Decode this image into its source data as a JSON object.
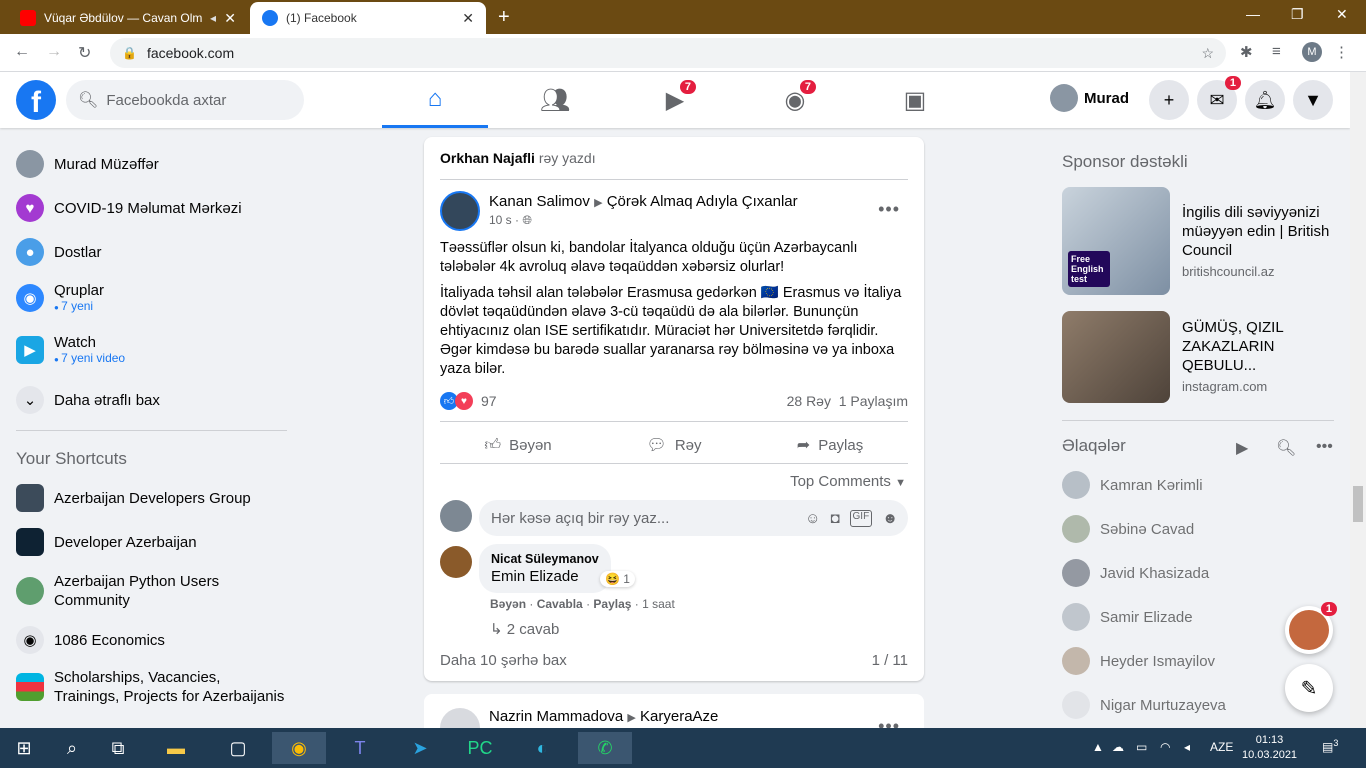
{
  "browser": {
    "tabs": [
      {
        "title": "Vüqar Əbdülov — Cavan Olm",
        "active": false,
        "icon": "youtube-icon"
      },
      {
        "title": "(1) Facebook",
        "active": true,
        "icon": "facebook-icon"
      }
    ],
    "url": "facebook.com",
    "profile_initial": "M"
  },
  "header": {
    "search_placeholder": "Facebookda axtar",
    "nav": [
      {
        "name": "home",
        "badge": ""
      },
      {
        "name": "friends",
        "badge": ""
      },
      {
        "name": "watch",
        "badge": "7"
      },
      {
        "name": "groups",
        "badge": "7"
      },
      {
        "name": "gaming",
        "badge": ""
      }
    ],
    "user_name": "Murad",
    "messenger_badge": "1"
  },
  "left": {
    "items": [
      {
        "label": "Murad Müzəffər",
        "sub": ""
      },
      {
        "label": "COVID-19 Məlumat Mərkəzi",
        "sub": ""
      },
      {
        "label": "Dostlar",
        "sub": ""
      },
      {
        "label": "Qruplar",
        "sub": "7 yeni"
      },
      {
        "label": "Watch",
        "sub": "7 yeni video"
      },
      {
        "label": "Daha ətraflı bax",
        "sub": ""
      }
    ],
    "shortcuts_title": "Your Shortcuts",
    "shortcuts": [
      "Azerbaijan Developers Group",
      "Developer Azerbaijan",
      "Azerbaijan Python Users Community",
      "1086 Economics",
      "Scholarships, Vacancies, Trainings, Projects for Azerbaijanis"
    ]
  },
  "post": {
    "context_name": "Orkhan Najafli",
    "context_text": "rəy yazdı",
    "author": "Kanan Salimov",
    "group": "Çörək Almaq Adıyla Çıxanlar",
    "time": "10 s",
    "para1": "Təəssüflər olsun ki, bandolar İtalyanca olduğu üçün Azərbaycanlı tələbələr 4k avroluq əlavə təqaüddən xəbərsiz olurlar!",
    "para2": "İtaliyada təhsil alan tələbələr Erasmusa gedərkən 🇪🇺 Erasmus və İtaliya dövlət təqaüdündən əlavə 3-cü təqaüdü də ala bilərlər. Bununçün ehtiyacınız olan ISE sertifikatıdır. Müraciət hər Universitetdə fərqlidir. Əgər kimdəsə bu barədə suallar yaranarsa rəy bölməsinə və ya inboxa yaza bilər.",
    "reactions_count": "97",
    "comments_count": "28 Rəy",
    "shares_count": "1 Paylaşım",
    "like": "Bəyən",
    "comment": "Rəy",
    "share": "Paylaş",
    "sort": "Top Comments",
    "comment_placeholder": "Hər kəsə açıq bir rəy yaz...",
    "comment_author": "Nicat Süleymanov",
    "comment_text": "Emin Elizade",
    "comment_reacts": "1",
    "comment_like": "Bəyən",
    "comment_reply": "Cavabla",
    "comment_share": "Paylaş",
    "comment_time": "1 saat",
    "replies": "2 cavab",
    "more_comments": "Daha 10 şərhə bax",
    "pager": "1 / 11"
  },
  "post2": {
    "author": "Nazrin Mammadova",
    "group": "KaryeraAze"
  },
  "right": {
    "sponsor_title": "Sponsor dəstəkli",
    "ads": [
      {
        "title": "İngilis dili səviyyənizi müəyyən edin | British Council",
        "domain": "britishcouncil.az",
        "badge": "Free English test"
      },
      {
        "title": "GÜMÜŞ, QIZIL ZAKAZLARIN QEBULU...",
        "domain": "instagram.com"
      }
    ],
    "contacts_title": "Əlaqələr",
    "contacts": [
      "Kamran Kərimli",
      "Səbinə Cavad",
      "Javid Khasizada",
      "Samir Elizade",
      "Heyder Ismayilov",
      "Nigar Murtuzayeva"
    ],
    "chat_badge": "1"
  },
  "taskbar": {
    "lang": "AZE",
    "time": "01:13",
    "date": "10.03.2021",
    "notif": "3"
  },
  "colors": {
    "brand": "#1877f2",
    "badge": "#e41e3f"
  }
}
